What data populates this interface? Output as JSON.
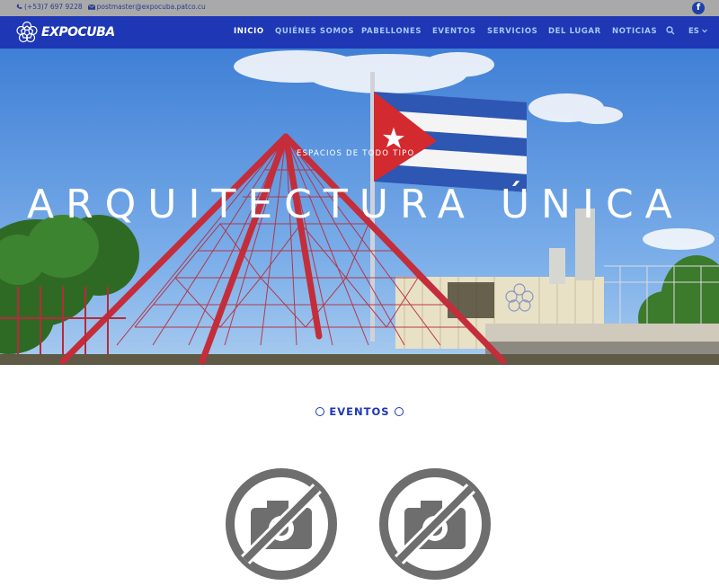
{
  "topbar": {
    "phone": "(+53)7 697 9228",
    "email": "postmaster@expocuba.patco.cu",
    "social_icon": "facebook-icon"
  },
  "brand": {
    "name": "EXPOCUBA"
  },
  "nav": {
    "items": [
      {
        "label": "INICIO",
        "active": true
      },
      {
        "label": "QUIÉNES SOMOS",
        "active": false
      },
      {
        "label": "PABELLONES",
        "active": false
      },
      {
        "label": "EVENTOS",
        "active": false
      },
      {
        "label": "SERVICIOS",
        "active": false
      },
      {
        "label": "DEL LUGAR",
        "active": false
      },
      {
        "label": "NOTICIAS",
        "active": false
      }
    ],
    "language": "ES",
    "search_icon": "search-icon"
  },
  "hero": {
    "kicker": "ESPACIOS DE TODO TIPO",
    "headline": "ARQUITECTURA ÚNICA"
  },
  "events": {
    "title": "EVENTOS",
    "cards": [
      {
        "icon": "no-photo-icon"
      },
      {
        "icon": "no-photo-icon"
      }
    ]
  },
  "colors": {
    "brand_blue": "#1e37b5",
    "topbar_gray": "#a9a9a9",
    "nav_link": "#a5c7f2"
  }
}
